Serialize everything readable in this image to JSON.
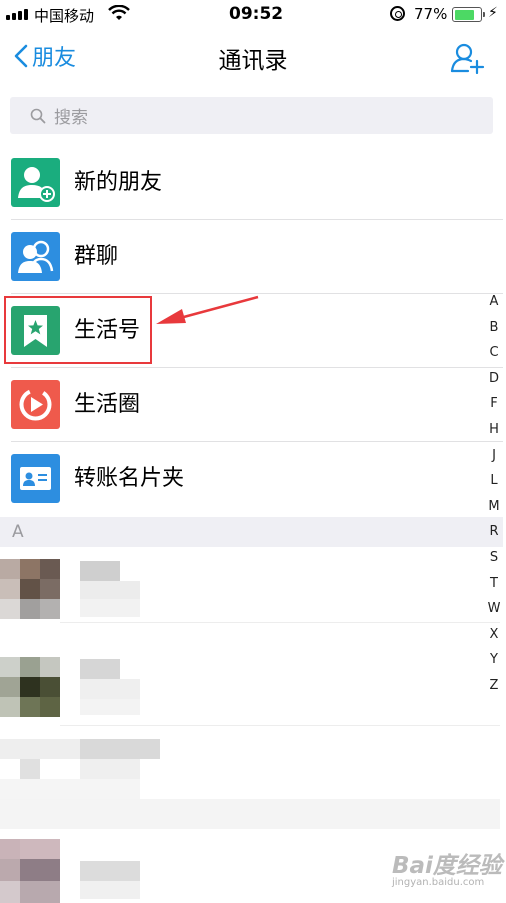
{
  "status_bar": {
    "carrier": "中国移动",
    "time": "09:52",
    "battery_percent": "77%",
    "battery_level": 0.77
  },
  "nav": {
    "back_label": "朋友",
    "title": "通讯录",
    "add_icon": "add-contact-icon"
  },
  "search": {
    "placeholder": "搜索"
  },
  "items": [
    {
      "label": "新的朋友",
      "icon": "new-friend-icon",
      "color": "#1aad7e"
    },
    {
      "label": "群聊",
      "icon": "group-chat-icon",
      "color": "#2d8ee0"
    },
    {
      "label": "生活号",
      "icon": "life-account-icon",
      "color": "#28a46f"
    },
    {
      "label": "生活圈",
      "icon": "life-circle-icon",
      "color": "#ef5a4c"
    },
    {
      "label": "转账名片夹",
      "icon": "card-holder-icon",
      "color": "#2d8ee0"
    }
  ],
  "section_header": "A",
  "index_letters": [
    "A",
    "B",
    "C",
    "D",
    "F",
    "H",
    "J",
    "L",
    "M",
    "R",
    "S",
    "T",
    "W",
    "X",
    "Y",
    "Z"
  ],
  "annotation": {
    "color": "#e8393c",
    "target": "生活号"
  },
  "watermark": {
    "brand": "Bai度经验",
    "url": "jingyan.baidu.com"
  }
}
